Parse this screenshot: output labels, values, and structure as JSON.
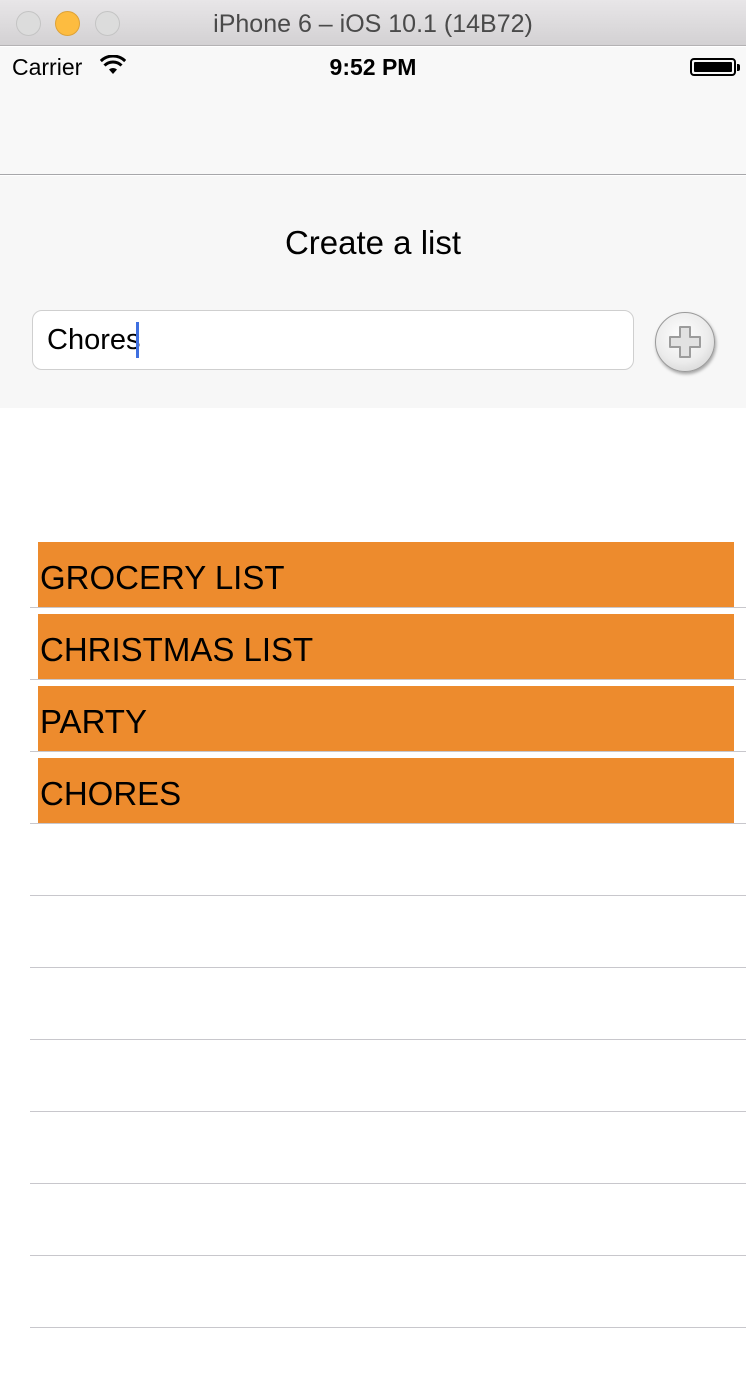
{
  "window": {
    "title": "iPhone 6 – iOS 10.1 (14B72)"
  },
  "status_bar": {
    "carrier": "Carrier",
    "time": "9:52 PM"
  },
  "creator": {
    "title": "Create a list",
    "input_value": "Chores",
    "add_button_label": "Add"
  },
  "lists": [
    {
      "label": "GROCERY LIST"
    },
    {
      "label": "CHRISTMAS LIST"
    },
    {
      "label": "PARTY"
    },
    {
      "label": "CHORES"
    }
  ],
  "colors": {
    "cell_accent": "#ed8b2d",
    "caret": "#3e6fe0"
  }
}
